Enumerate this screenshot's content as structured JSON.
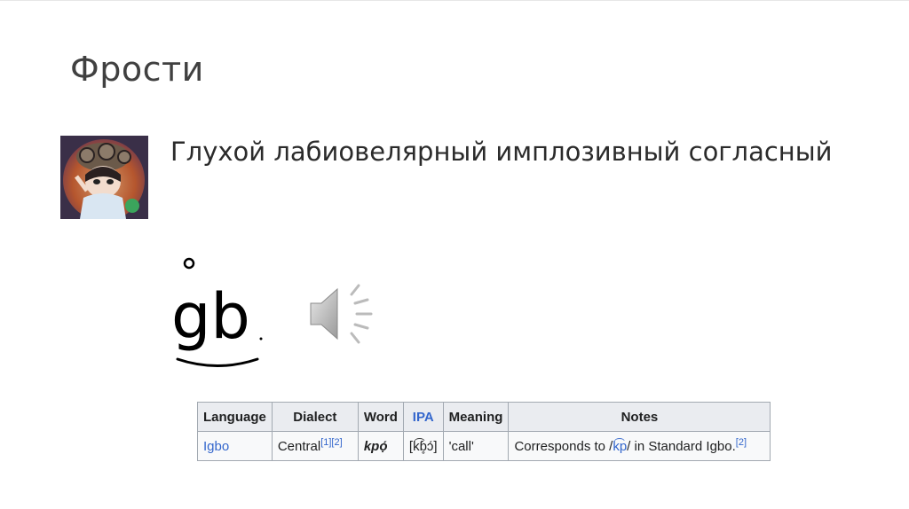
{
  "slide": {
    "title": "Фрости",
    "subtitle": "Глухой лабиовелярный имплозивный согласный"
  },
  "table": {
    "headers": [
      "Language",
      "Dialect",
      "Word",
      "IPA",
      "Meaning",
      "Notes"
    ],
    "row": {
      "language": "Igbo",
      "dialect": "Central",
      "dialect_refs": "[1][2]",
      "word": "kpọ́",
      "ipa": "[k͡ɓ̥ɔ́]",
      "meaning": "'call'",
      "notes_prefix": "Corresponds to /",
      "notes_link": "k͡p",
      "notes_suffix": "/ in Standard Igbo.",
      "notes_ref": "[2]"
    }
  },
  "colors": {
    "link": "#3366cc",
    "header_bg": "#eaecf0",
    "cell_bg": "#f8f9fa",
    "border": "#a2a9b1"
  }
}
